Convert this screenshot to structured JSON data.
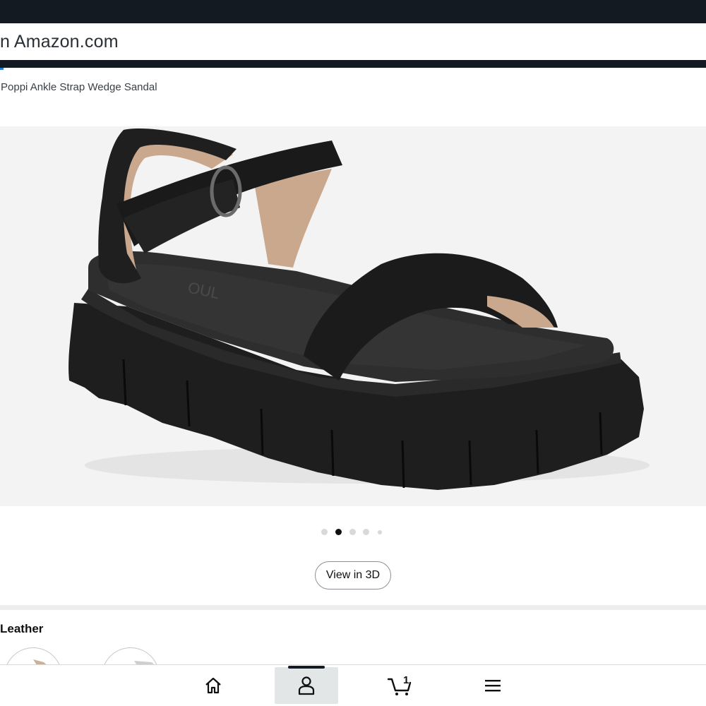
{
  "header": {
    "search_text": "n Amazon.com"
  },
  "product": {
    "title": "Poppi Ankle Strap Wedge Sandal",
    "image_alt": "black-wedge-sandal-image",
    "image_brand_mark": "OUL"
  },
  "carousel": {
    "dots": [
      {
        "active": false
      },
      {
        "active": true
      },
      {
        "active": false
      },
      {
        "active": false
      },
      {
        "active": false
      }
    ]
  },
  "view3d": {
    "label": "View in 3D"
  },
  "color_section": {
    "label": "Leather"
  },
  "bottom_nav": {
    "items": [
      {
        "name": "home",
        "icon": "home-icon"
      },
      {
        "name": "account",
        "icon": "person-icon",
        "active": true
      },
      {
        "name": "cart",
        "icon": "cart-icon",
        "count": "1"
      },
      {
        "name": "menu",
        "icon": "hamburger-menu-icon"
      }
    ]
  },
  "colors": {
    "topbar": "#131a22",
    "page_bg": "#ffffff",
    "image_bg": "#f3f3f3",
    "active_nav_bg": "#e3e6e6"
  }
}
